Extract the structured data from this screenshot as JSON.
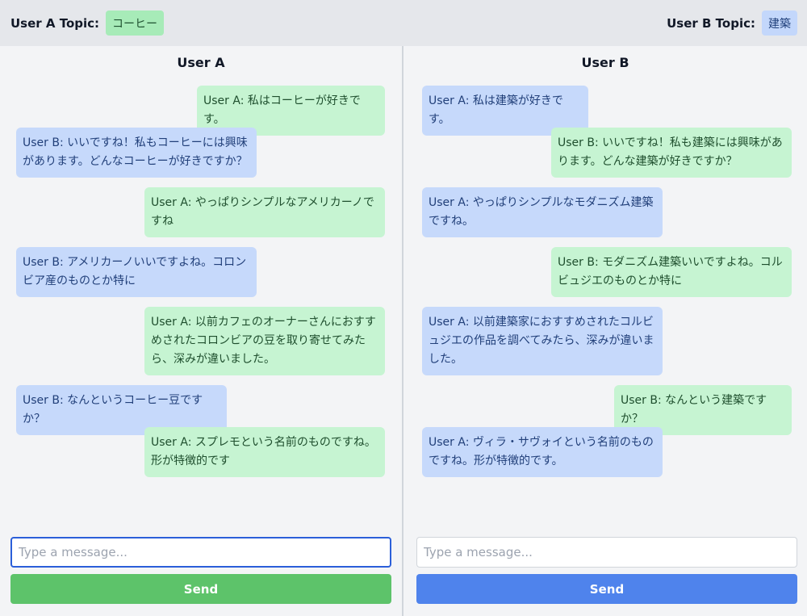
{
  "header": {
    "user_a_topic_label": "User A Topic:",
    "user_a_topic": "コーヒー",
    "user_b_topic_label": "User B Topic:",
    "user_b_topic": "建築"
  },
  "pane_a": {
    "title": "User A",
    "messages": [
      "User A: 私はコーヒーが好きです。",
      "User B: いいですね！私もコーヒーには興味があります。どんなコーヒーが好きですか？",
      "User A: やっぱりシンプルなアメリカーノですね",
      "User B: アメリカーノいいですよね。コロンビア産のものとか特に",
      "User A: 以前カフェのオーナーさんにおすすめされたコロンビアの豆を取り寄せてみたら、深みが違いました。",
      "User B: なんというコーヒー豆ですか？",
      "User A: スプレモという名前のものですね。形が特徴的です"
    ],
    "input_placeholder": "Type a message...",
    "send_label": "Send"
  },
  "pane_b": {
    "title": "User B",
    "messages": [
      "User A: 私は建築が好きです。",
      "User B: いいですね！私も建築には興味があります。どんな建築が好きですか？",
      "User A: やっぱりシンプルなモダニズム建築ですね。",
      "User B: モダニズム建築いいですよね。コルビュジエのものとか特に",
      "User A: 以前建築家におすすめされたコルビュジエの作品を調べてみたら、深みが違いました。",
      "User B: なんという建築ですか？",
      "User A: ヴィラ・サヴォイという名前のものですね。形が特徴的です。"
    ],
    "input_placeholder": "Type a message...",
    "send_label": "Send"
  },
  "colors": {
    "user_a_bubble": "#c6f4d2",
    "user_b_bubble": "#c6d9fb",
    "user_a_send": "#5dc36a",
    "user_b_send": "#4f83ec"
  }
}
